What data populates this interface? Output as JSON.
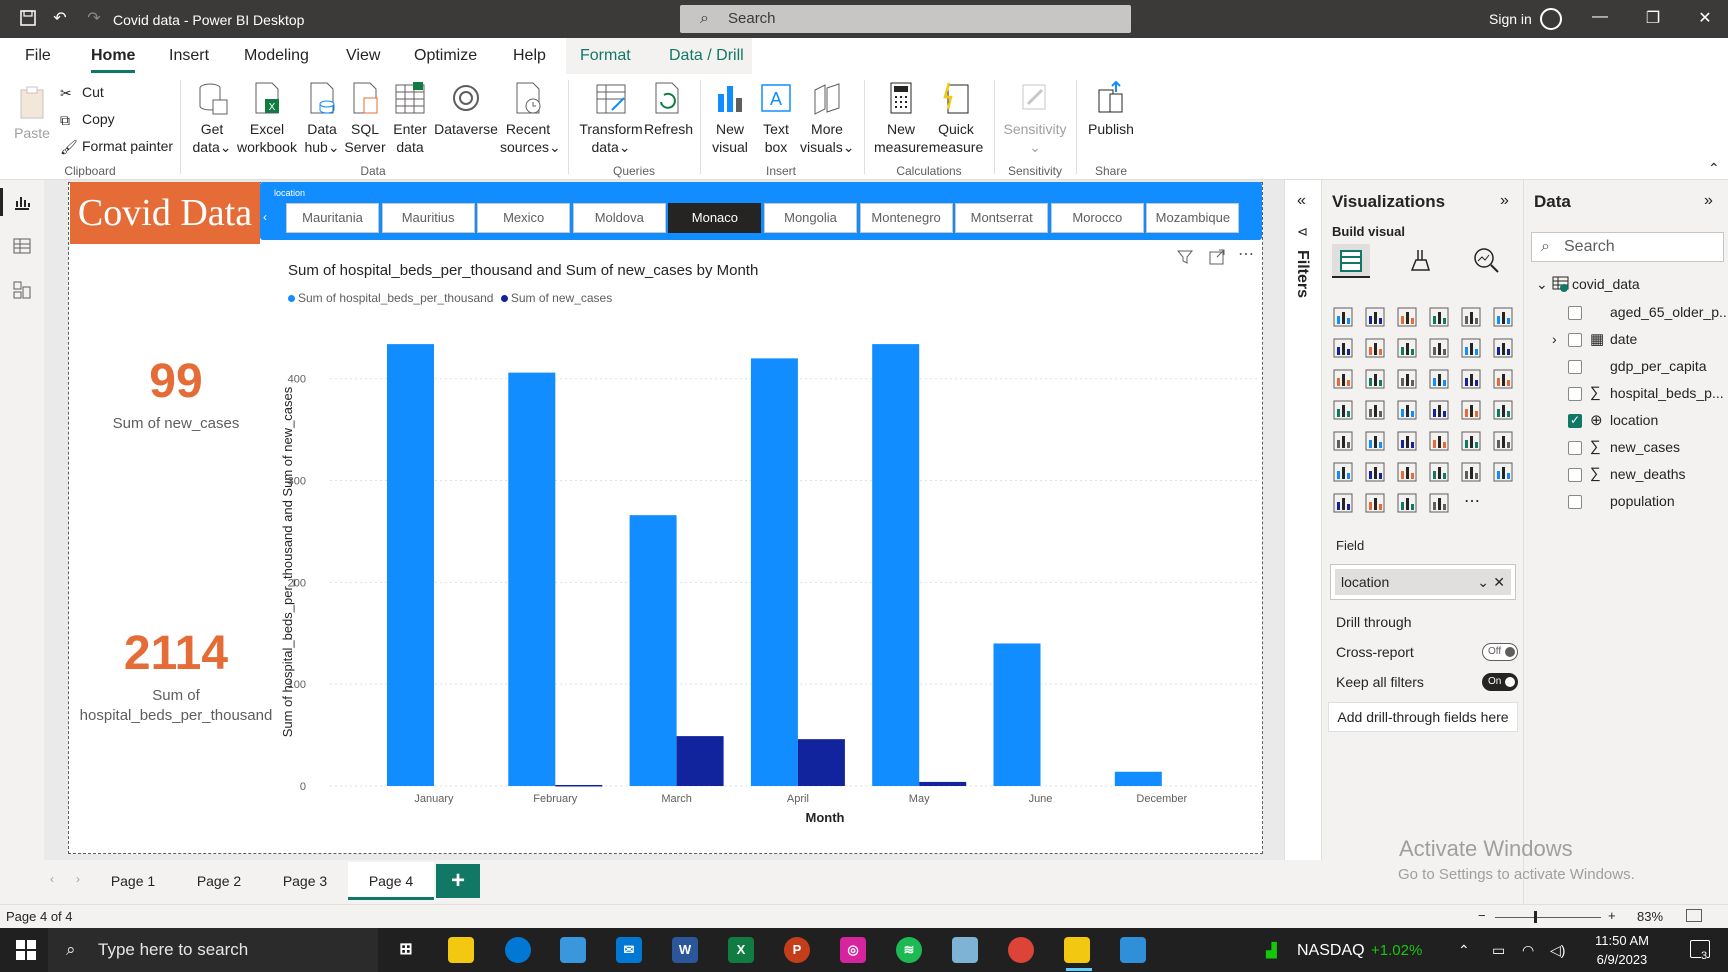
{
  "titlebar": {
    "title": "Covid data - Power BI Desktop",
    "search": "Search",
    "signin": "Sign in"
  },
  "menu": {
    "file": "File",
    "home": "Home",
    "insert": "Insert",
    "modeling": "Modeling",
    "view": "View",
    "optimize": "Optimize",
    "help": "Help",
    "format": "Format",
    "drill": "Data / Drill"
  },
  "ribbon": {
    "paste": "Paste",
    "cut": "Cut",
    "copy": "Copy",
    "format_painter": "Format painter",
    "clipboard": "Clipboard",
    "get_data_1": "Get",
    "get_data_2": "data",
    "excel_1": "Excel",
    "excel_2": "workbook",
    "hub_1": "Data",
    "hub_2": "hub",
    "sql_1": "SQL",
    "sql_2": "Server",
    "enter_1": "Enter",
    "enter_2": "data",
    "dataverse": "Dataverse",
    "recent_1": "Recent",
    "recent_2": "sources",
    "data_group": "Data",
    "transform_1": "Transform",
    "transform_2": "data",
    "refresh": "Refresh",
    "queries_group": "Queries",
    "newvis_1": "New",
    "newvis_2": "visual",
    "textbox_1": "Text",
    "textbox_2": "box",
    "morevis_1": "More",
    "morevis_2": "visuals",
    "insert_group": "Insert",
    "newmeasure_1": "New",
    "newmeasure_2": "measure",
    "quick_1": "Quick",
    "quick_2": "measure",
    "calc_group": "Calculations",
    "sensitivity": "Sensitivity",
    "sensitivity_group": "Sensitivity",
    "publish": "Publish",
    "share_group": "Share"
  },
  "report": {
    "title": "Covid Data",
    "slicer_label": "location",
    "slicer_items": [
      "Mauritania",
      "Mauritius",
      "Mexico",
      "Moldova",
      "Monaco",
      "Mongolia",
      "Montenegro",
      "Montserrat",
      "Morocco",
      "Mozambique"
    ],
    "kpi1_value": "99",
    "kpi1_label": "Sum of new_cases",
    "kpi2_value": "2114",
    "kpi2_label_1": "Sum of",
    "kpi2_label_2": "hospital_beds_per_thousand"
  },
  "chart_data": {
    "type": "bar",
    "title": "Sum of hospital_beds_per_thousand and Sum of new_cases by Month",
    "xlabel": "Month",
    "ylabel": "Sum of hospital_beds_per_thousand and Sum of new_cases",
    "categories": [
      "January",
      "February",
      "March",
      "April",
      "May",
      "June",
      "December"
    ],
    "series": [
      {
        "name": "Sum of hospital_beds_per_thousand",
        "color": "#118dff",
        "values": [
          434,
          406,
          266,
          420,
          434,
          140,
          14
        ]
      },
      {
        "name": "Sum of new_cases",
        "color": "#12239e",
        "values": [
          0,
          1,
          49,
          46,
          4,
          0,
          0
        ]
      }
    ],
    "yticks": [
      0,
      100,
      200,
      300,
      400
    ],
    "ylim": [
      0,
      440
    ],
    "grid": true,
    "legend": "top-left"
  },
  "pages": {
    "p1": "Page 1",
    "p2": "Page 2",
    "p3": "Page 3",
    "p4": "Page 4",
    "add": "+"
  },
  "filters": {
    "label": "Filters"
  },
  "viz": {
    "title": "Visualizations",
    "build": "Build visual",
    "field_label": "Field",
    "field_value": "location",
    "drill_through": "Drill through",
    "cross_report": "Cross-report",
    "cross_report_state": "Off",
    "keep_filters": "Keep all filters",
    "keep_filters_state": "On",
    "add_drill": "Add drill-through fields here"
  },
  "data_pane": {
    "title": "Data",
    "search": "Search",
    "table": "covid_data",
    "fields": [
      "aged_65_older_p...",
      "date",
      "gdp_per_capita",
      "hospital_beds_p...",
      "location",
      "new_cases",
      "new_deaths",
      "population"
    ]
  },
  "watermark": {
    "line1": "Activate Windows",
    "line2": "Go to Settings to activate Windows."
  },
  "status": {
    "page": "Page 4 of 4",
    "zoom": "83%"
  },
  "taskbar": {
    "search": "Type here to search",
    "ticker": "NASDAQ",
    "ticker_change": "+1.02%",
    "time": "11:50 AM",
    "date": "6/9/2023",
    "notif": "3"
  }
}
